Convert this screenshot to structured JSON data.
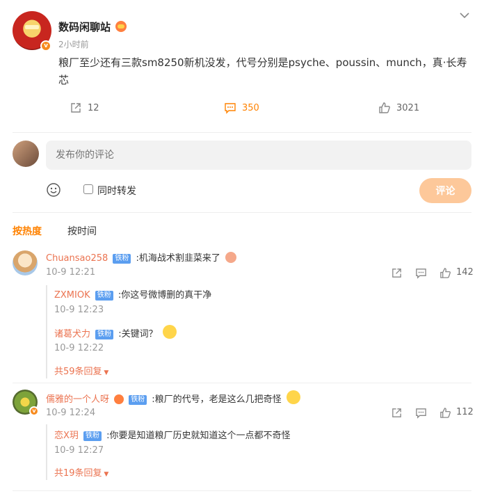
{
  "post": {
    "author": "数码闲聊站",
    "time": "2小时前",
    "content": "粮厂至少还有三款sm8250新机没发，代号分别是psyche、poussin、munch，真·长寿芯",
    "share_count": "12",
    "comment_count": "350",
    "like_count": "3021",
    "accent_color": "#ff8200"
  },
  "composer": {
    "placeholder": "发布你的评论",
    "repost_label": "同时转发",
    "submit_label": "评论"
  },
  "sort": {
    "hot": "按热度",
    "time": "按时间"
  },
  "badge": "铁粉",
  "comments": [
    {
      "name": "Chuansao258",
      "text": ":机海战术割韭菜来了",
      "time": "10-9 12:21",
      "likes": "142",
      "replies": [
        {
          "name": "ZXMIOK",
          "text": ":你这号微博删的真干净",
          "time": "10-9 12:23"
        },
        {
          "name": "诸葛犬力",
          "text": ":关键词？",
          "time": "10-9 12:22"
        }
      ],
      "more": "共59条回复"
    },
    {
      "name": "儒雅的一个人呀",
      "text": ":粮厂的代号，老是这么几把奇怪",
      "time": "10-9 12:24",
      "likes": "112",
      "replies": [
        {
          "name": "恋X玥",
          "text": ":你要是知道粮厂历史就知道这个一点都不奇怪",
          "time": "10-9 12:27"
        }
      ],
      "more": "共19条回复"
    }
  ]
}
